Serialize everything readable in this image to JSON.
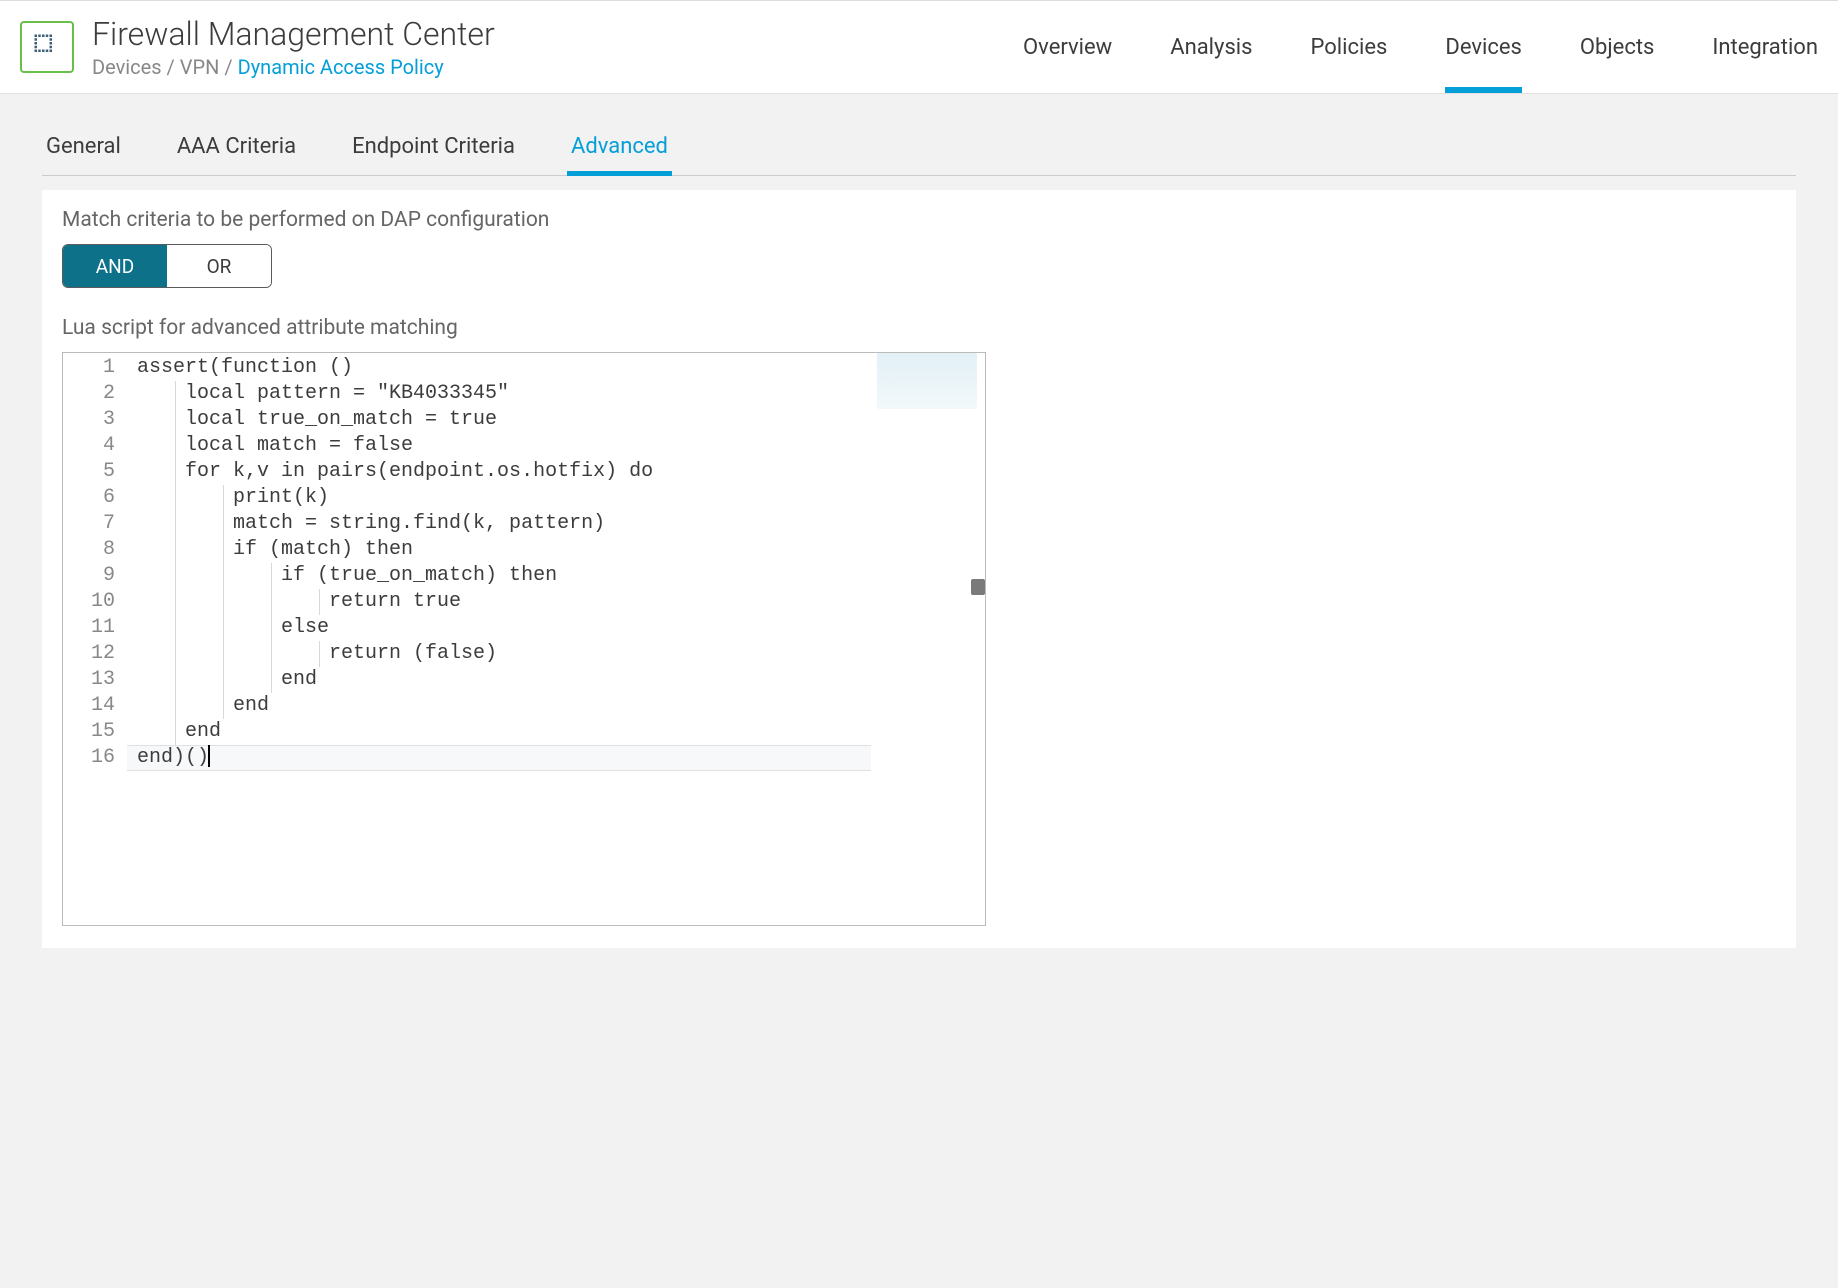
{
  "header": {
    "app_title": "Firewall Management Center",
    "breadcrumb": {
      "part1": "Devices",
      "part2": "VPN",
      "current": "Dynamic Access Policy",
      "separator": " / "
    },
    "nav": [
      {
        "label": "Overview",
        "active": false
      },
      {
        "label": "Analysis",
        "active": false
      },
      {
        "label": "Policies",
        "active": false
      },
      {
        "label": "Devices",
        "active": true
      },
      {
        "label": "Objects",
        "active": false
      },
      {
        "label": "Integration",
        "active": false
      }
    ]
  },
  "subtabs": [
    {
      "label": "General",
      "active": false
    },
    {
      "label": "AAA Criteria",
      "active": false
    },
    {
      "label": "Endpoint Criteria",
      "active": false
    },
    {
      "label": "Advanced",
      "active": true
    }
  ],
  "match": {
    "heading": "Match criteria to be performed on DAP configuration",
    "and": "AND",
    "or": "OR",
    "and_active": true
  },
  "editor": {
    "label": "Lua script for advanced attribute matching",
    "lines": [
      "assert(function ()",
      "    local pattern = \"KB4033345\"",
      "    local true_on_match = true",
      "    local match = false",
      "    for k,v in pairs(endpoint.os.hotfix) do",
      "        print(k)",
      "        match = string.find(k, pattern)",
      "        if (match) then",
      "            if (true_on_match) then",
      "                return true",
      "            else",
      "                return (false)",
      "            end",
      "        end",
      "    end",
      "end)()"
    ],
    "current_line": 16
  }
}
